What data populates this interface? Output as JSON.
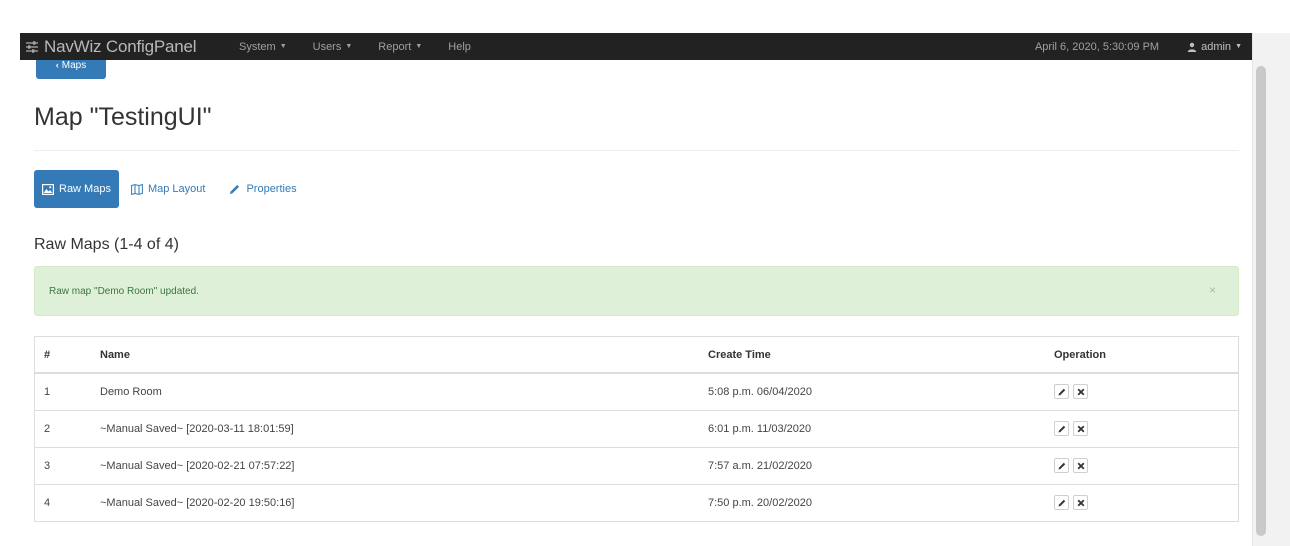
{
  "navbar": {
    "brand": "NavWiz ConfigPanel",
    "menus": [
      {
        "label": "System",
        "has_caret": true
      },
      {
        "label": "Users",
        "has_caret": true
      },
      {
        "label": "Report",
        "has_caret": true
      },
      {
        "label": "Help",
        "has_caret": false
      }
    ],
    "datetime": "April 6, 2020, 5:30:09 PM",
    "user": "admin"
  },
  "back_button": {
    "label": "Maps",
    "icon": "chevron-left-icon"
  },
  "page": {
    "title": "Map \"TestingUI\""
  },
  "tabs": [
    {
      "label": "Raw Maps",
      "icon": "image-icon",
      "active": true
    },
    {
      "label": "Map Layout",
      "icon": "map-icon",
      "active": false
    },
    {
      "label": "Properties",
      "icon": "pencil-icon",
      "active": false
    }
  ],
  "section": {
    "heading": "Raw Maps (1-4 of 4)"
  },
  "alert": {
    "message": "Raw map \"Demo Room\" updated.",
    "close": "×"
  },
  "table": {
    "headers": {
      "num": "#",
      "name": "Name",
      "time": "Create Time",
      "op": "Operation"
    },
    "rows": [
      {
        "num": "1",
        "name": "Demo Room",
        "time": "5:08 p.m. 06/04/2020"
      },
      {
        "num": "2",
        "name": "~Manual Saved~ [2020-03-11 18:01:59]",
        "time": "6:01 p.m. 11/03/2020"
      },
      {
        "num": "3",
        "name": "~Manual Saved~ [2020-02-21 07:57:22]",
        "time": "7:57 a.m. 21/02/2020"
      },
      {
        "num": "4",
        "name": "~Manual Saved~ [2020-02-20 19:50:16]",
        "time": "7:50 p.m. 20/02/2020"
      }
    ]
  },
  "colors": {
    "navbar": "#222222",
    "primary": "#337ab7",
    "alert_bg": "#dff0d8",
    "alert_text": "#3c763d"
  }
}
